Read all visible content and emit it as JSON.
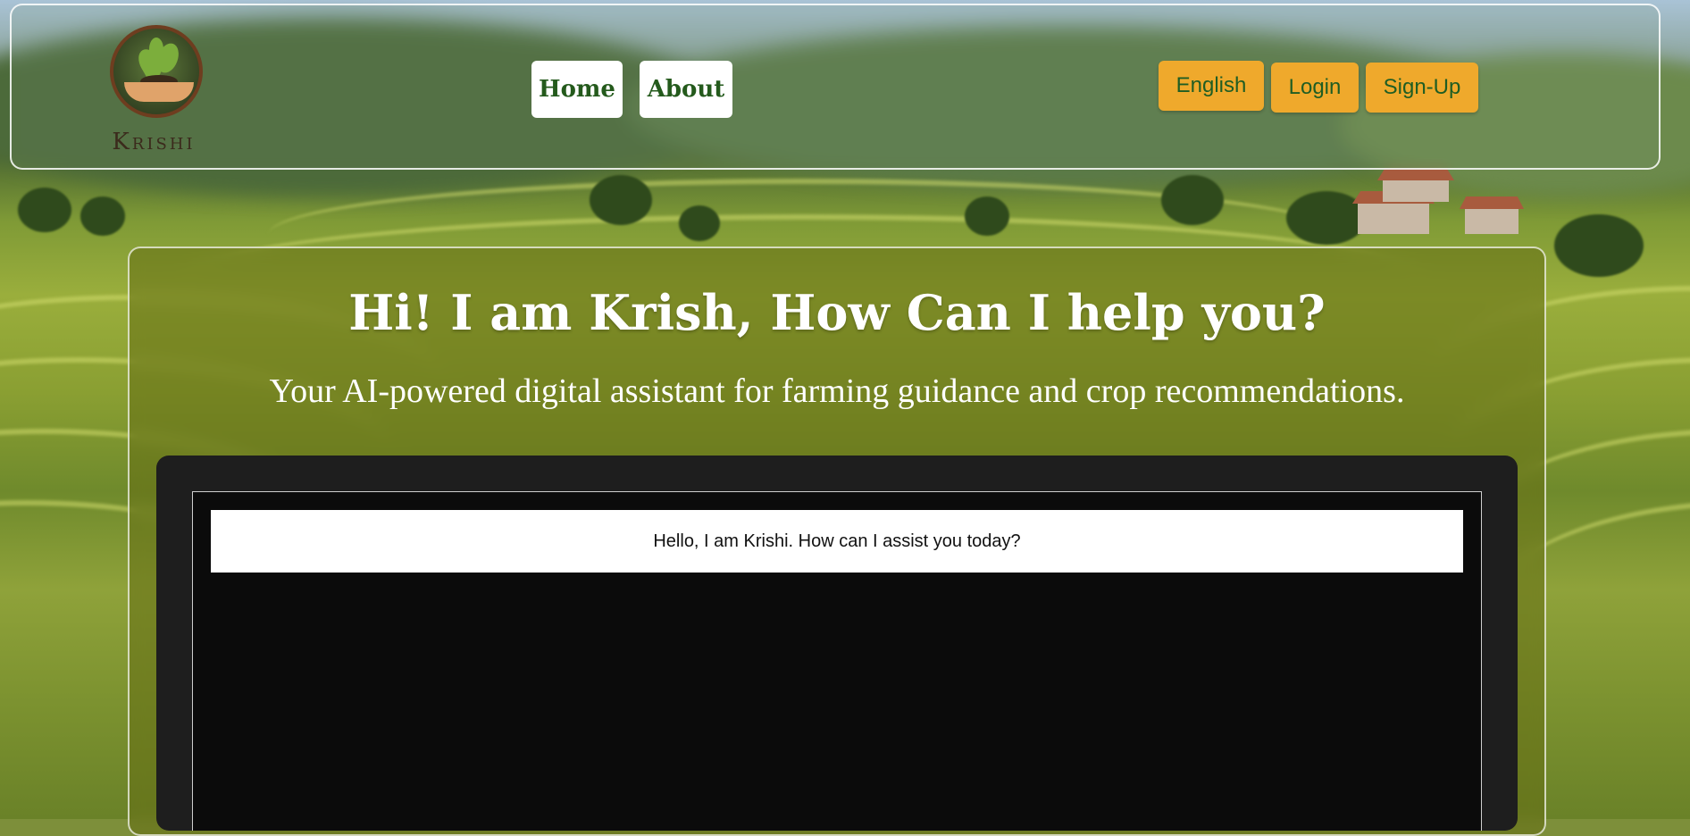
{
  "brand": {
    "name": "Krishi"
  },
  "nav": {
    "home": "Home",
    "about": "About"
  },
  "header_actions": {
    "language": "English",
    "login": "Login",
    "signup": "Sign-Up"
  },
  "hero": {
    "title": "Hi! I am Krish, How Can I help you?",
    "subtitle": "Your AI-powered digital assistant for farming guidance and crop recommendations."
  },
  "chat": {
    "messages": [
      {
        "text": "Hello, I am Krishi. How can I assist you today?"
      }
    ]
  },
  "colors": {
    "button_yellow": "#efa92c",
    "nav_text_green": "#245a1c",
    "chat_bg": "#1e1e1e",
    "chat_inner_bg": "#0b0b0b"
  }
}
